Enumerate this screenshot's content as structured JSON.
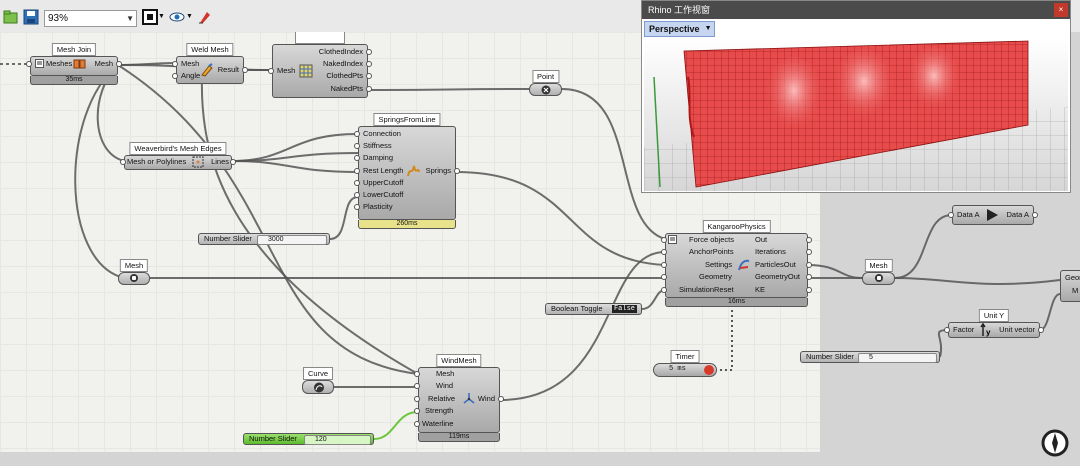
{
  "toolbar": {
    "zoom_value": "93%"
  },
  "components": {
    "mesh_join": {
      "nickname": "Mesh Join",
      "inputs": [
        "Meshes"
      ],
      "outputs": [
        "Mesh"
      ],
      "timing": "35ms"
    },
    "weld_mesh": {
      "nickname": "Weld Mesh",
      "inputs": [
        "Mesh",
        "Angle"
      ],
      "outputs": [
        "Result"
      ]
    },
    "naked_edges": {
      "inputs": [
        "Mesh"
      ],
      "outputs": [
        "ClothedIndex",
        "NakedIndex",
        "ClothedPts",
        "NakedPts"
      ]
    },
    "point_param": {
      "nickname": "Point"
    },
    "mesh_edges": {
      "nickname": "Weaverbird's Mesh Edges",
      "inputs": [
        "Mesh or Polylines"
      ],
      "outputs": [
        "Lines"
      ]
    },
    "springs": {
      "nickname": "SpringsFromLine",
      "inputs": [
        "Connection",
        "Stiffness",
        "Damping",
        "Rest Length",
        "UpperCutoff",
        "LowerCutoff",
        "Plasticity"
      ],
      "outputs": [
        "Springs"
      ],
      "timing": "260ms"
    },
    "number_slider_1": {
      "label": "Number Slider",
      "value": "3000"
    },
    "mesh_param_1": {
      "nickname": "Mesh"
    },
    "kangaroo": {
      "nickname": "KangarooPhysics",
      "inputs": [
        "Force objects",
        "AnchorPoints",
        "Settings",
        "Geometry",
        "SimulationReset"
      ],
      "outputs": [
        "Out",
        "Iterations",
        "ParticlesOut",
        "GeometryOut",
        "KE"
      ],
      "timing": "16ms"
    },
    "boolean_toggle": {
      "label": "Boolean Toggle",
      "value": "False"
    },
    "timer": {
      "nickname": "Timer",
      "value": "5 ms"
    },
    "curve_param": {
      "nickname": "Curve"
    },
    "wind_mesh": {
      "nickname": "WindMesh",
      "inputs": [
        "Mesh",
        "Wind",
        "Relative",
        "Strength",
        "Waterline"
      ],
      "outputs": [
        "Wind"
      ],
      "timing": "119ms"
    },
    "number_slider_2": {
      "label": "Number Slider",
      "value": "120"
    },
    "mesh_param_2": {
      "nickname": "Mesh"
    },
    "data_relay": {
      "inputs": [
        "Data A"
      ],
      "outputs": [
        "Data A"
      ]
    },
    "unit_y": {
      "nickname": "Unit Y",
      "inputs": [
        "Factor"
      ],
      "outputs": [
        "Unit vector"
      ]
    },
    "number_slider_3": {
      "label": "Number Slider",
      "value": "5"
    },
    "partial_right": {
      "rows": [
        "Geom",
        "M"
      ]
    }
  },
  "rhino_window": {
    "title": "Rhino 工作视窗",
    "close_glyph": "×",
    "viewport_label": "Perspective"
  },
  "colors": {
    "mesh_red": "#e84b4b",
    "canvas_bg": "#f1f1ee",
    "slider_green": "#6cc63b",
    "timing_warn": "#e8e28a"
  }
}
